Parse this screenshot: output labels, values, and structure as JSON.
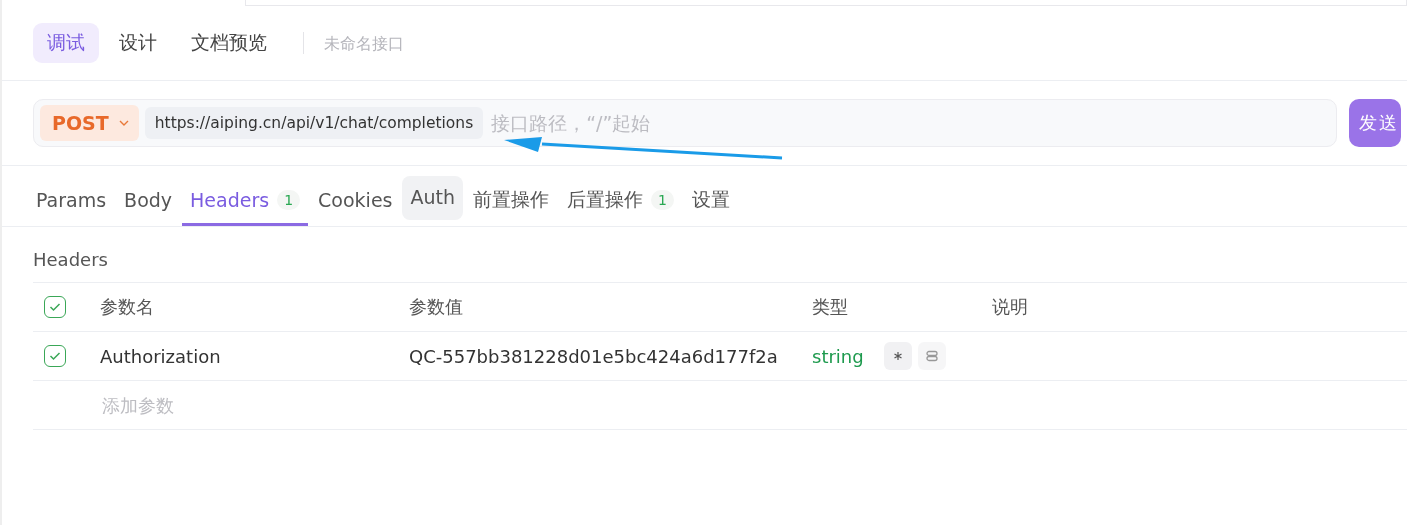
{
  "mode_tabs": [
    {
      "label": "调试",
      "selected": true
    },
    {
      "label": "设计",
      "selected": false
    },
    {
      "label": "文档预览",
      "selected": false
    }
  ],
  "api_name": {
    "placeholder": "未命名接口"
  },
  "request": {
    "method": "POST",
    "url": "https://aiping.cn/api/v1/chat/completions",
    "path_placeholder": "接口路径，“/”起始",
    "send": "发送"
  },
  "request_tabs": [
    {
      "label": "Params",
      "selected": false
    },
    {
      "label": "Body",
      "selected": false
    },
    {
      "label": "Headers",
      "selected": true,
      "count": "1"
    },
    {
      "label": "Cookies",
      "selected": false
    },
    {
      "label": "Auth",
      "selected": false,
      "hovered": true
    },
    {
      "label": "前置操作",
      "selected": false
    },
    {
      "label": "后置操作",
      "selected": false,
      "count": "1"
    },
    {
      "label": "设置",
      "selected": false
    }
  ],
  "section_title": "Headers",
  "table": {
    "all_checked": true,
    "columns": [
      "参数名",
      "参数值",
      "类型",
      "说明"
    ],
    "rows": [
      {
        "checked": true,
        "name": "Authorization",
        "value": "QC-557bb381228d01e5bc424a6d177f2a",
        "type": "string",
        "required": true
      }
    ],
    "add_placeholder": "添加参数"
  }
}
